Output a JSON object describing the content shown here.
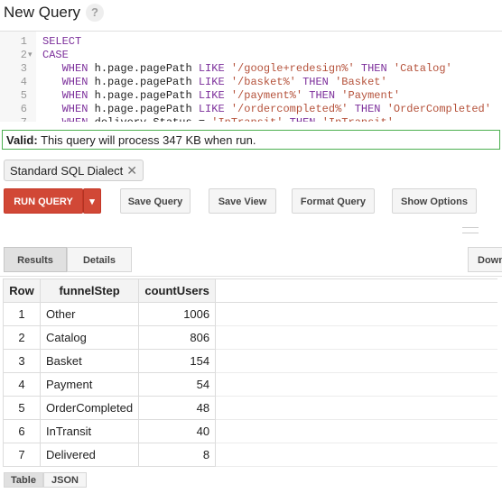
{
  "header": {
    "title": "New Query",
    "help": "?"
  },
  "editor": {
    "lines": [
      {
        "n": "1",
        "fold": "",
        "t": "SELECT"
      },
      {
        "n": "2",
        "fold": "▾",
        "t": "CASE"
      },
      {
        "n": "3",
        "fold": "",
        "t": "   WHEN h.page.pagePath LIKE '/google+redesign%' THEN 'Catalog'"
      },
      {
        "n": "4",
        "fold": "",
        "t": "   WHEN h.page.pagePath LIKE '/basket%' THEN 'Basket'"
      },
      {
        "n": "5",
        "fold": "",
        "t": "   WHEN h.page.pagePath LIKE '/payment%' THEN 'Payment'"
      },
      {
        "n": "6",
        "fold": "",
        "t": "   WHEN h.page.pagePath LIKE '/ordercompleted%' THEN 'OrderCompleted'"
      },
      {
        "n": "7",
        "fold": "",
        "t": "   WHEN delivery.Status = 'InTransit' THEN 'InTransit'"
      }
    ]
  },
  "validation": {
    "label": "Valid:",
    "message": " This query will process 347 KB when run."
  },
  "dialect": {
    "label": "Standard SQL Dialect",
    "close": "✕"
  },
  "toolbar": {
    "run": "RUN QUERY",
    "caret": "▾",
    "save_query": "Save Query",
    "save_view": "Save View",
    "format_query": "Format Query",
    "show_options": "Show Options"
  },
  "tabs": {
    "results": "Results",
    "details": "Details",
    "download": "Download"
  },
  "table": {
    "headers": [
      "Row",
      "funnelStep",
      "countUsers"
    ],
    "rows": [
      [
        "1",
        "Other",
        "1006"
      ],
      [
        "2",
        "Catalog",
        "806"
      ],
      [
        "3",
        "Basket",
        "154"
      ],
      [
        "4",
        "Payment",
        "54"
      ],
      [
        "5",
        "OrderCompleted",
        "48"
      ],
      [
        "6",
        "InTransit",
        "40"
      ],
      [
        "7",
        "Delivered",
        "8"
      ]
    ]
  },
  "views": {
    "table": "Table",
    "json": "JSON"
  }
}
